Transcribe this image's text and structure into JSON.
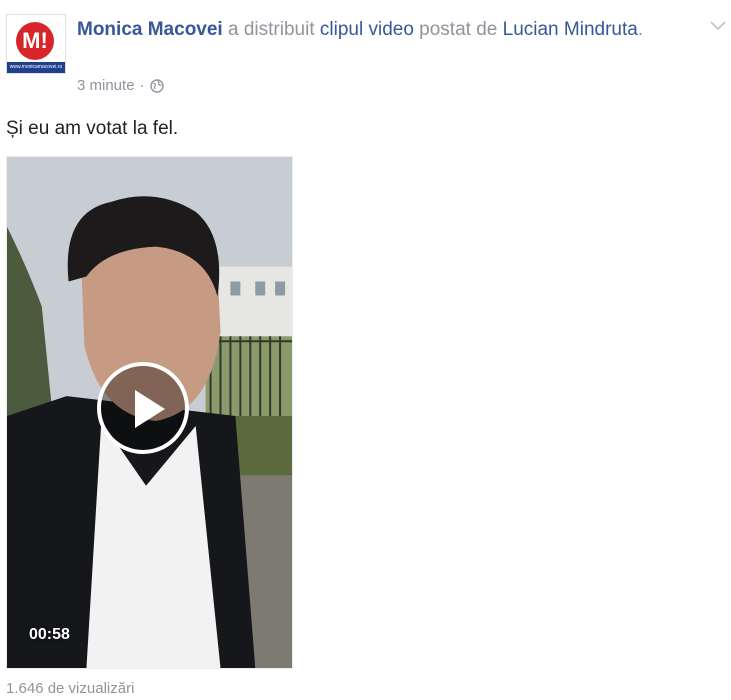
{
  "page": {
    "logo_badge": "M!",
    "logo_caption": "www.monicamacovei.ro"
  },
  "post": {
    "author": "Monica Macovei",
    "action_text": "a distribuit",
    "shared_item": "clipul video",
    "posted_by_text": "postat de",
    "original_author": "Lucian Mindruta",
    "period": ".",
    "time": "3 minute",
    "separator": "·",
    "privacy_icon": "globe-icon",
    "options_icon": "chevron-down-icon",
    "message": "Și eu am votat la fel.",
    "video": {
      "duration": "00:58",
      "play_icon": "play-icon"
    },
    "views": "1.646 de vizualizări"
  },
  "colors": {
    "link": "#365899",
    "meta": "#90949c",
    "text": "#1d2129",
    "logo_red": "#d7262b",
    "logo_blue": "#1f3f8f"
  }
}
